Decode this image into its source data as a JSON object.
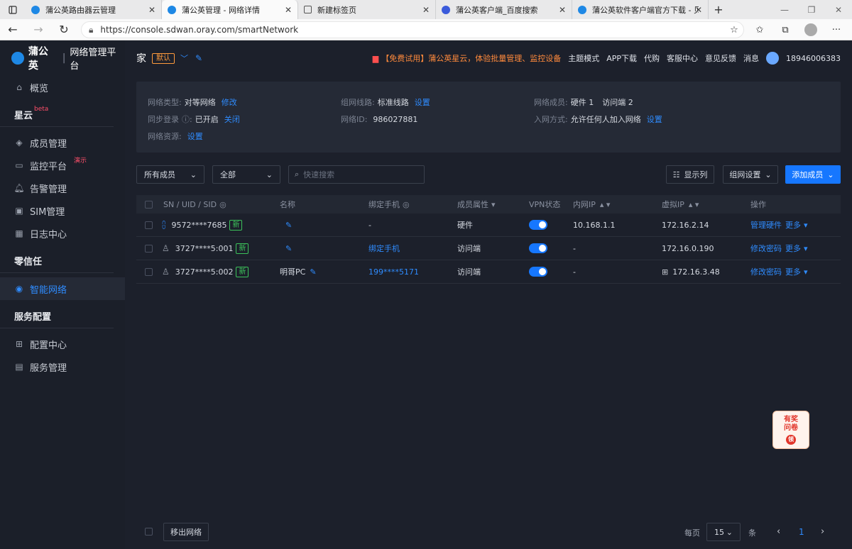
{
  "browser": {
    "tabs": [
      {
        "title": "蒲公英路由器云管理",
        "active": false
      },
      {
        "title": "蒲公英管理 - 网络详情",
        "active": true
      },
      {
        "title": "新建标签页",
        "active": false
      },
      {
        "title": "蒲公英客户端_百度搜索",
        "active": false
      },
      {
        "title": "蒲公英软件客户端官方下载 - 贝",
        "active": false
      }
    ],
    "url": "https://console.sdwan.oray.com/smartNetwork"
  },
  "brand": {
    "name": "蒲公英",
    "sep": "|",
    "sub": "网络管理平台"
  },
  "sidebar": {
    "overview": "概览",
    "group_xingyun": "星云",
    "beta": "beta",
    "members": "成员管理",
    "monitor": "监控平台",
    "demo": "演示",
    "alarm": "告警管理",
    "sim": "SIM管理",
    "logs": "日志中心",
    "group_zerotrust": "零信任",
    "smartnet": "智能网络",
    "group_service": "服务配置",
    "config": "配置中心",
    "service": "服务管理"
  },
  "topbar": {
    "net_name": "家",
    "default_badge": "默认",
    "promo": "【免费试用】蒲公英星云，体验批量管理、监控设备",
    "theme": "主题模式",
    "app": "APP下载",
    "agent": "代购",
    "support": "客服中心",
    "feedback": "意见反馈",
    "messages": "消息",
    "user": "18946006383"
  },
  "info": {
    "type_k": "网络类型:",
    "type_v": "对等网络",
    "type_link": "修改",
    "line_k": "组网线路:",
    "line_v": "标准线路",
    "line_link": "设置",
    "members_k": "网络成员:",
    "members_v1": "硬件 1",
    "members_v2": "访问端 2",
    "sync_k": "同步登录",
    "sync_v": "已开启",
    "sync_link": "关闭",
    "id_k": "网络ID:",
    "id_v": "986027881",
    "join_k": "入网方式:",
    "join_v": "允许任何人加入网络",
    "join_link": "设置",
    "res_k": "网络资源:",
    "res_link": "设置"
  },
  "toolbar": {
    "filter1": "所有成员",
    "filter2": "全部",
    "search_placeholder": "快速搜索",
    "columns_btn": "显示列",
    "net_settings_btn": "组网设置",
    "add_btn": "添加成员"
  },
  "table": {
    "headers": [
      "SN / UID / SID",
      "名称",
      "绑定手机",
      "成员属性",
      "VPN状态",
      "内网IP",
      "虚拟IP",
      "操作"
    ],
    "rows": [
      {
        "id": "9572****7685",
        "new": "新",
        "name": "",
        "phone": "-",
        "attr": "硬件",
        "lan_ip": "10.168.1.1",
        "vip": "172.16.2.14",
        "action": "管理硬件",
        "more": "更多"
      },
      {
        "id": "3727****5:001",
        "new": "新",
        "name": "",
        "phone": "绑定手机",
        "attr": "访问端",
        "lan_ip": "-",
        "vip": "172.16.0.190",
        "action": "修改密码",
        "more": "更多"
      },
      {
        "id": "3727****5:002",
        "new": "新",
        "name": "明哥PC",
        "phone": "199****5171",
        "attr": "访问端",
        "lan_ip": "-",
        "vip": "172.16.3.48",
        "action": "修改密码",
        "more": "更多"
      }
    ]
  },
  "footer": {
    "remove_btn": "移出网络",
    "per_page": "每页",
    "page_size": "15",
    "unit": "条",
    "page": "1"
  },
  "survey": {
    "line1": "有奖",
    "line2": "问卷",
    "coin": "领"
  }
}
